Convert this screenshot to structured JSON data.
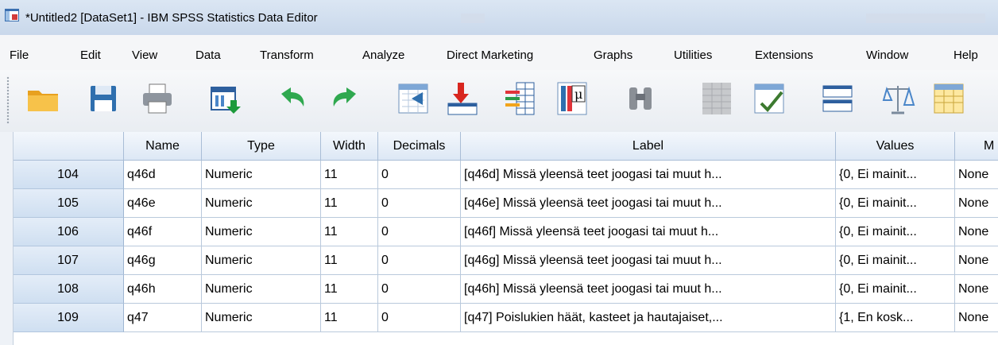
{
  "window": {
    "title": "*Untitled2 [DataSet1] - IBM SPSS Statistics Data Editor"
  },
  "menu": [
    {
      "label": "File"
    },
    {
      "label": "Edit"
    },
    {
      "label": "View"
    },
    {
      "label": "Data"
    },
    {
      "label": "Transform"
    },
    {
      "label": "Analyze"
    },
    {
      "label": "Direct Marketing"
    },
    {
      "label": "Graphs"
    },
    {
      "label": "Utilities"
    },
    {
      "label": "Extensions"
    },
    {
      "label": "Window"
    },
    {
      "label": "Help"
    }
  ],
  "toolbar": [
    {
      "icon": "open-folder-icon"
    },
    {
      "icon": "save-icon"
    },
    {
      "icon": "print-icon"
    },
    {
      "icon": "recall-dialog-icon"
    },
    {
      "icon": "undo-icon"
    },
    {
      "icon": "redo-icon"
    },
    {
      "icon": "go-to-case-icon"
    },
    {
      "icon": "go-to-variable-icon"
    },
    {
      "icon": "variables-icon"
    },
    {
      "icon": "run-descriptives-icon"
    },
    {
      "icon": "find-icon"
    },
    {
      "icon": "insert-cases-icon"
    },
    {
      "icon": "insert-variable-icon"
    },
    {
      "icon": "split-file-icon"
    },
    {
      "icon": "weight-cases-icon"
    },
    {
      "icon": "select-cases-icon"
    }
  ],
  "grid": {
    "columns": [
      "",
      "Name",
      "Type",
      "Width",
      "Decimals",
      "Label",
      "Values",
      "M"
    ],
    "rows": [
      [
        "104",
        "q46d",
        "Numeric",
        "11",
        "0",
        "[q46d] Missä yleensä teet joogasi tai muut h...",
        "{0, Ei mainit...",
        "None"
      ],
      [
        "105",
        "q46e",
        "Numeric",
        "11",
        "0",
        "[q46e] Missä yleensä teet joogasi tai muut h...",
        "{0, Ei mainit...",
        "None"
      ],
      [
        "106",
        "q46f",
        "Numeric",
        "11",
        "0",
        "[q46f] Missä yleensä teet joogasi tai muut h...",
        "{0, Ei mainit...",
        "None"
      ],
      [
        "107",
        "q46g",
        "Numeric",
        "11",
        "0",
        "[q46g] Missä yleensä teet joogasi tai muut h...",
        "{0, Ei mainit...",
        "None"
      ],
      [
        "108",
        "q46h",
        "Numeric",
        "11",
        "0",
        "[q46h] Missä yleensä teet joogasi tai muut h...",
        "{0, Ei mainit...",
        "None"
      ],
      [
        "109",
        "q47",
        "Numeric",
        "11",
        "0",
        "[q47] Poislukien häät, kasteet ja hautajaiset,...",
        "{1, En kosk...",
        "None"
      ]
    ]
  }
}
